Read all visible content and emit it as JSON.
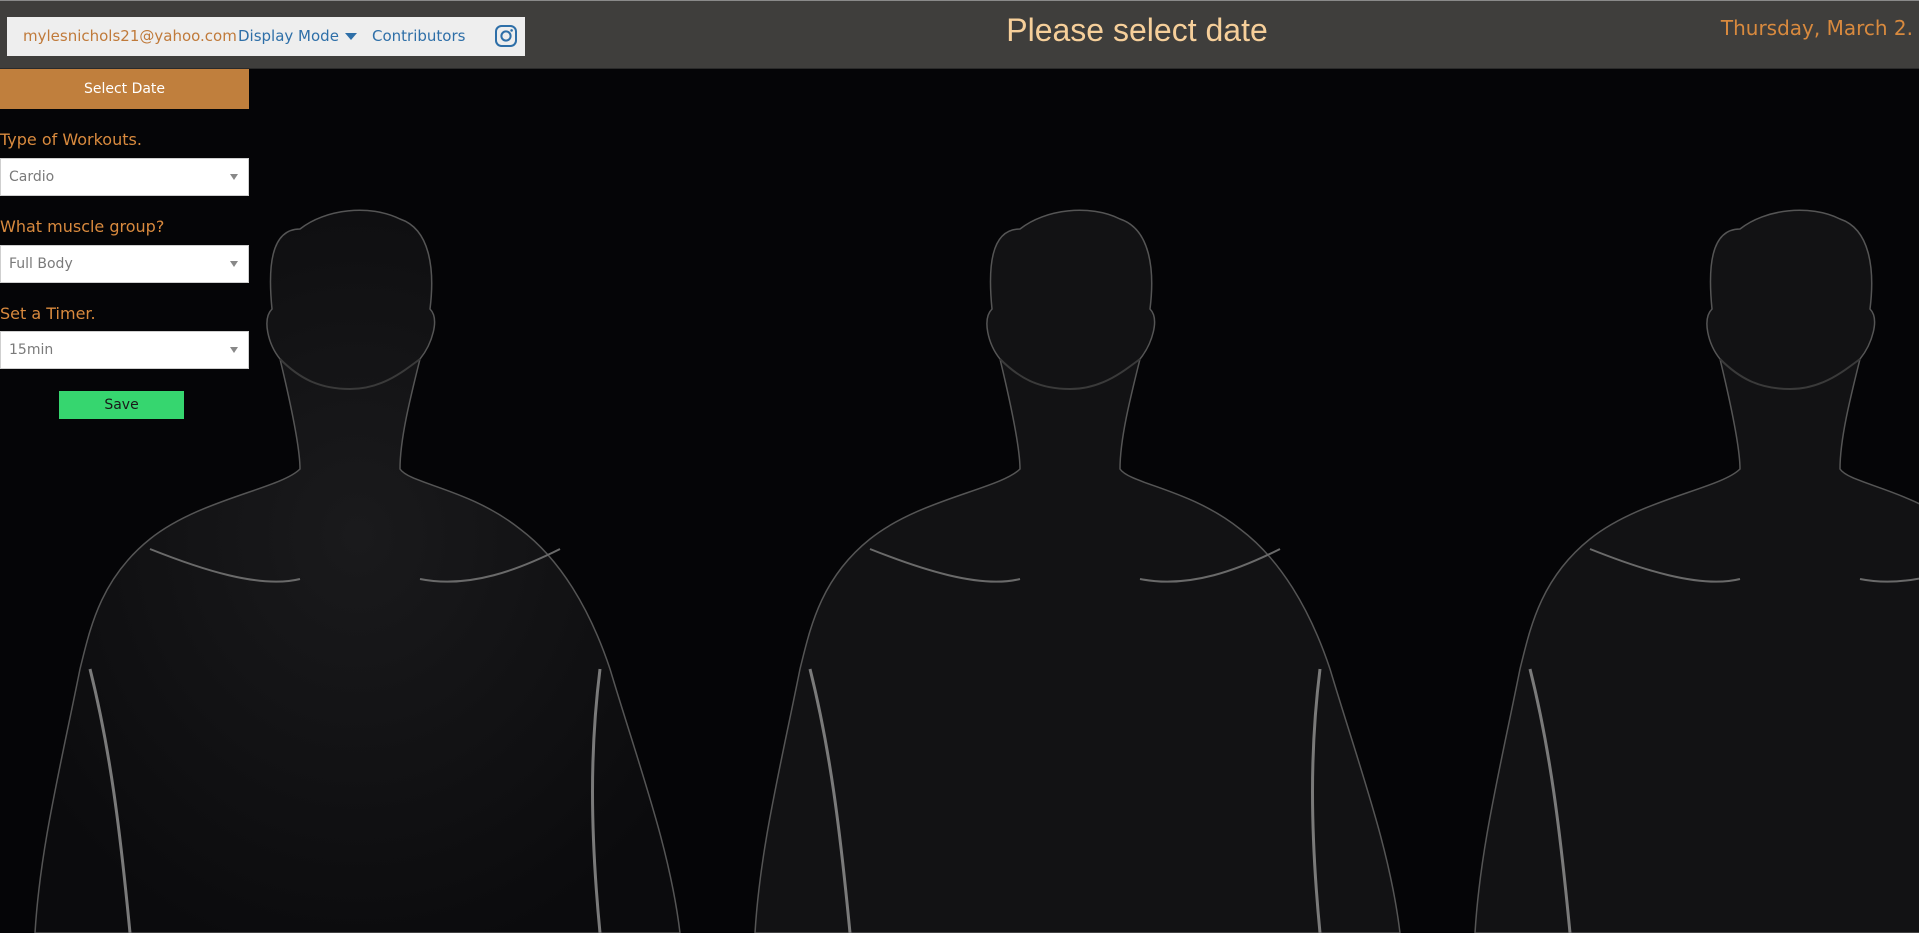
{
  "header": {
    "email": "mylesnichols21@yahoo.com",
    "display_mode": "Display Mode",
    "contributors": "Contributors",
    "title": "Please select date",
    "date": "Thursday, March 2."
  },
  "sidebar": {
    "select_date": "Select Date",
    "workout_label": "Type of Workouts.",
    "workout_value": "Cardio",
    "muscle_label": "What muscle group?",
    "muscle_value": "Full Body",
    "timer_label": "Set a Timer.",
    "timer_value": "15min",
    "save": "Save"
  },
  "colors": {
    "accent": "#c07f3d",
    "header_bg": "#3f3e3c",
    "title": "#f6cf9a",
    "link": "#2e6fa8",
    "save": "#36d66f"
  },
  "icons": {
    "social": "instagram-icon",
    "dropdown": "caret-down-icon"
  }
}
